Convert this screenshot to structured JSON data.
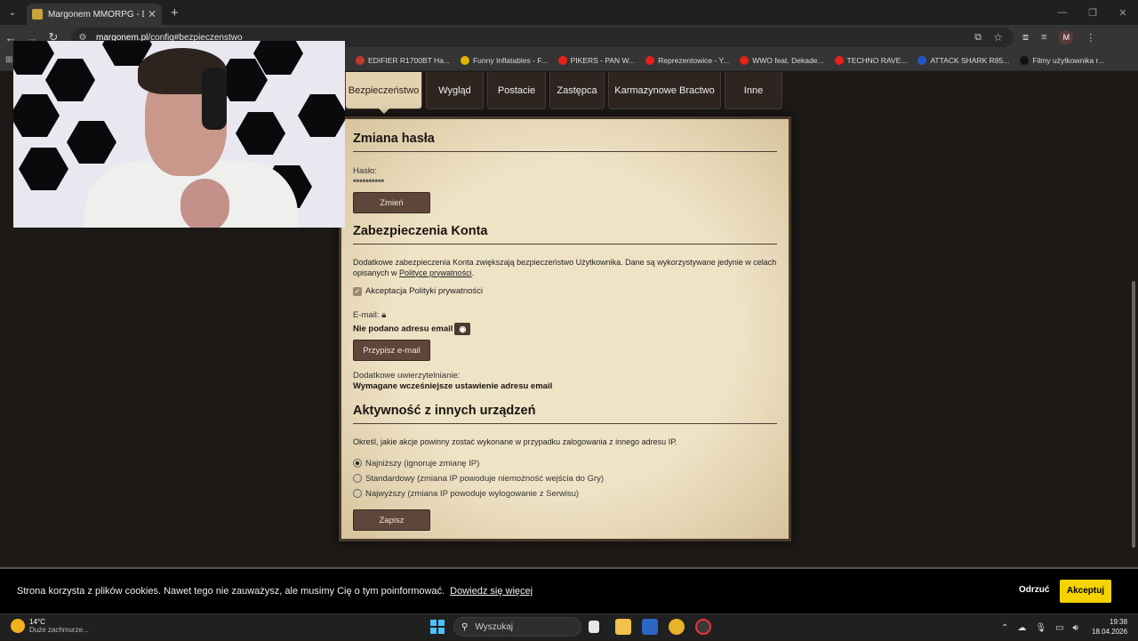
{
  "browser": {
    "tab_title": "Margonem MMORPG - Dynam",
    "url": "margonem.pl/config#bezpieczenstwo",
    "url_domain": "margonem.pl",
    "url_path": "/config#bezpieczenstwo",
    "profile_initial": "M",
    "bookmarks": [
      {
        "label": "EDIFIER R1700BT Ha...",
        "color": "#c0392b"
      },
      {
        "label": "Funny Inflatables - F...",
        "color": "#e0b300"
      },
      {
        "label": "PIKERS - PAN W...",
        "color": "#e62117"
      },
      {
        "label": "Reprezentowice - Y...",
        "color": "#e62117"
      },
      {
        "label": "WWO feat. Dekade...",
        "color": "#e62117"
      },
      {
        "label": "TECHNO RAVE...",
        "color": "#e62117"
      },
      {
        "label": "ATTACK SHARK R85...",
        "color": "#2455c9"
      },
      {
        "label": "Filmy użytkownika r...",
        "color": "#111111"
      }
    ]
  },
  "config_tabs": [
    {
      "label": "Bezpieczeństwo",
      "active": true
    },
    {
      "label": "Wygląd",
      "active": false
    },
    {
      "label": "Postacie",
      "active": false
    },
    {
      "label": "Zastępca",
      "active": false
    },
    {
      "label": "Karmazynowe Bractwo",
      "active": false
    },
    {
      "label": "Inne",
      "active": false
    }
  ],
  "password_section": {
    "title": "Zmiana hasła",
    "label": "Hasło:",
    "value": "**********",
    "button": "Zmień"
  },
  "security_section": {
    "title": "Zabezpieczenia Konta",
    "description_1": "Dodatkowe zabezpieczenia Konta zwiększają bezpieczeństwo Użytkownika. Dane są wykorzystywane jedynie w celach opisanych w ",
    "description_link": "Polityce prywatności",
    "description_2": ".",
    "privacy_checkbox": "Akceptacja Polityki prywatności",
    "email_label": "E-mail:",
    "email_status": "Nie podano adresu email",
    "email_button": "Przypisz e-mail",
    "auth_label": "Dodatkowe uwierzytelnianie:",
    "auth_status": "Wymagane wcześniejsze ustawienie adresu email"
  },
  "activity_section": {
    "title": "Aktywność z innych urządzeń",
    "description": "Określ, jakie akcje powinny zostać wykonane w przypadku zalogowania z innego adresu IP.",
    "options": [
      {
        "label": "Najniższy (ignoruje zmianę IP)",
        "selected": true
      },
      {
        "label": "Standardowy (zmiana IP powoduje niemożność wejścia do Gry)",
        "selected": false
      },
      {
        "label": "Najwyższy (zmiana IP powoduje wylogowanie z Serwisu)",
        "selected": false
      }
    ],
    "save_button": "Zapisz"
  },
  "cookie_banner": {
    "text": "Strona korzysta z plików cookies. Nawet tego nie zauważysz, ale musimy Cię o tym poinformować.",
    "link": "Dowiedz się więcej",
    "reject": "Odrzuć",
    "accept": "Akceptuj"
  },
  "taskbar": {
    "temperature": "14°C",
    "weather": "Duże zachmurze...",
    "search_placeholder": "Wyszukaj",
    "time": "19:38",
    "date": "18.04.2026"
  }
}
